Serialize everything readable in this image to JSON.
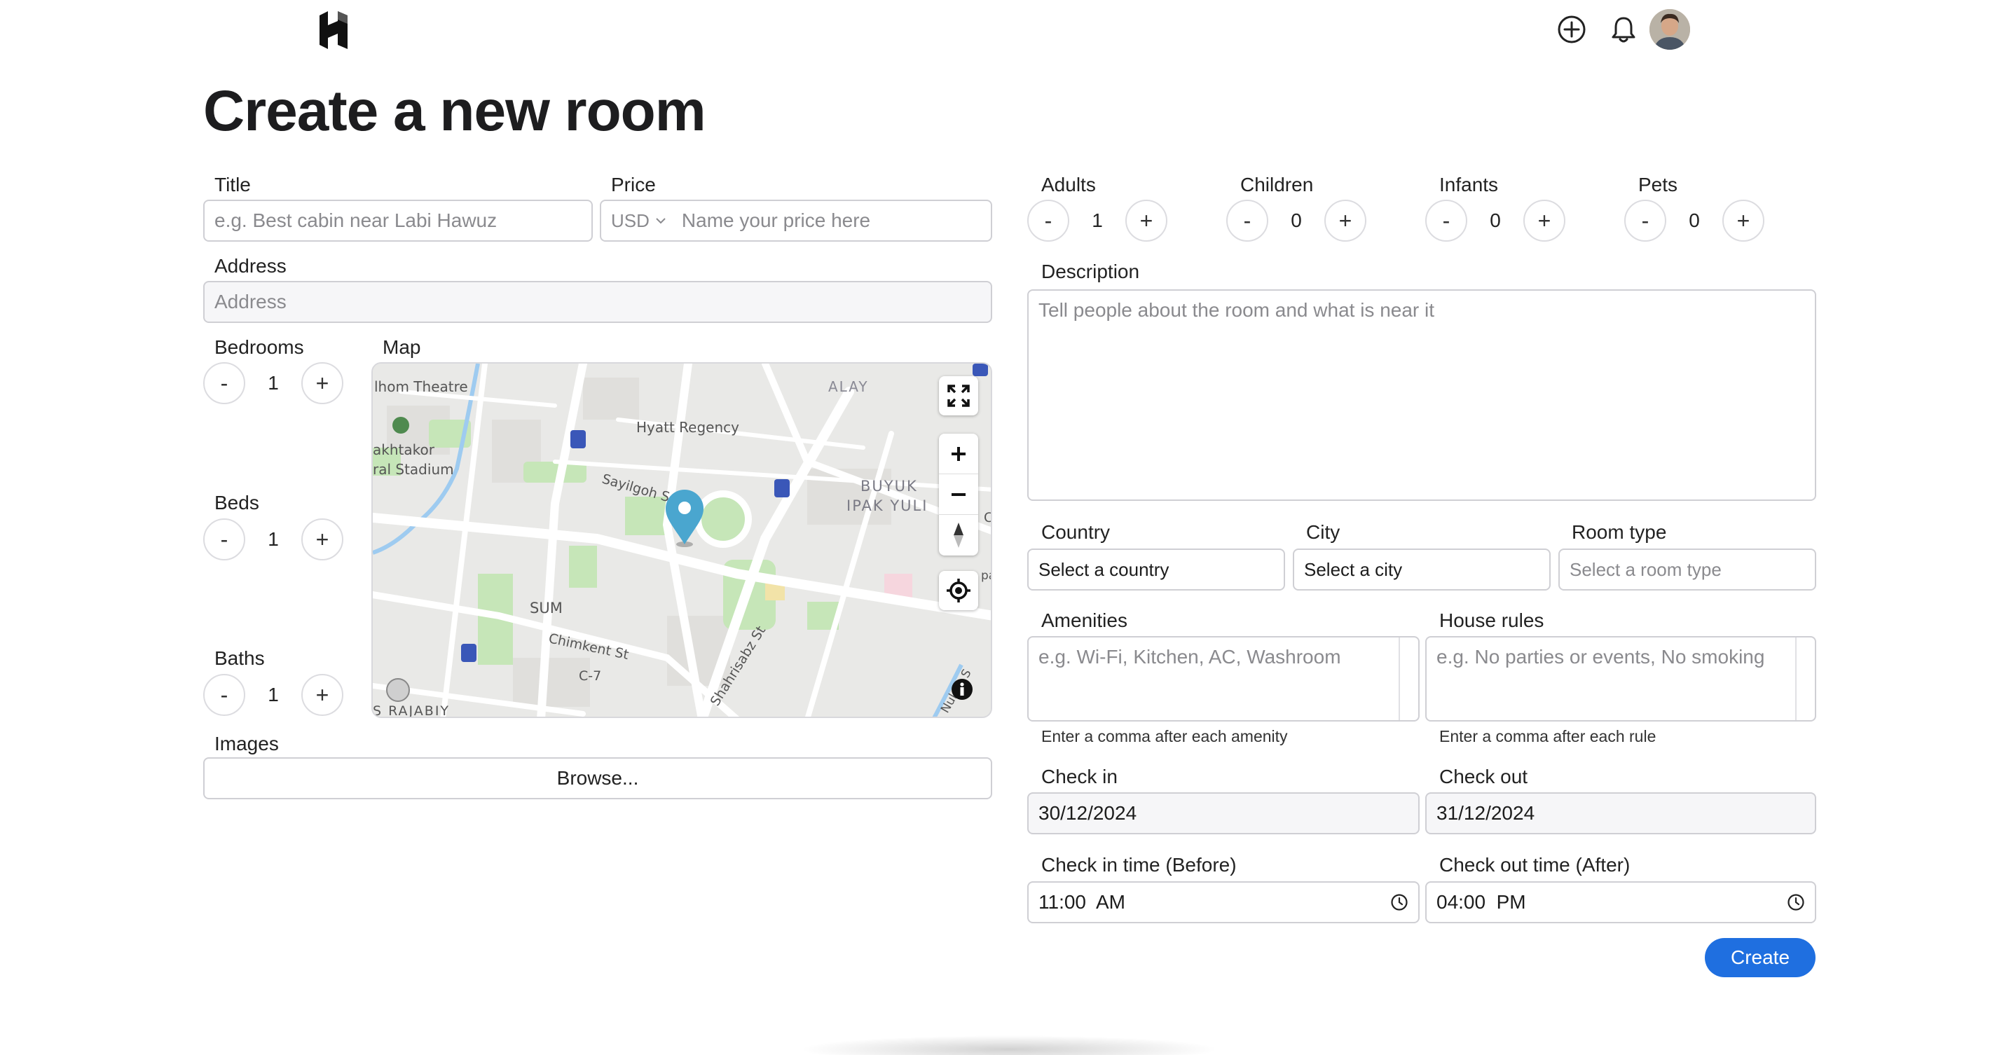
{
  "app": {
    "logo_letter": "H"
  },
  "header": {
    "add_icon": "plus-circle-icon",
    "bell_icon": "bell-icon",
    "avatar_icon": "user-avatar"
  },
  "page": {
    "title": "Create a new room"
  },
  "form": {
    "title": {
      "label": "Title",
      "placeholder": "e.g. Best cabin near Labi Hawuz"
    },
    "price": {
      "label": "Price",
      "currency": "USD",
      "placeholder": "Name your price here"
    },
    "address": {
      "label": "Address",
      "placeholder": "Address"
    },
    "bedrooms": {
      "label": "Bedrooms",
      "value": "1",
      "minus": "-",
      "plus": "+"
    },
    "beds": {
      "label": "Beds",
      "value": "1",
      "minus": "-",
      "plus": "+"
    },
    "baths": {
      "label": "Baths",
      "value": "1",
      "minus": "-",
      "plus": "+"
    },
    "map": {
      "label": "Map",
      "places": {
        "theatre": "lhom Theatre",
        "alay": "ALAY",
        "hyatt": "Hyatt Regency",
        "stadium1": "akhtakor",
        "stadium2": "ral Stadium",
        "sayilgoh": "Sayilgoh S",
        "buyuk1": "BUYUK",
        "buyuk2": "IPAK YULI",
        "sum": "SUM",
        "chimkent": "Chimkent St",
        "c7": "C-7",
        "shahrisabz": "Shahrisabz St",
        "rajabiy": "S RAJABIY",
        "nukus": "Nukus S",
        "pa": "pa",
        "c_edge": "C"
      }
    },
    "images": {
      "label": "Images",
      "browse": "Browse..."
    },
    "adults": {
      "label": "Adults",
      "value": "1",
      "minus": "-",
      "plus": "+"
    },
    "children": {
      "label": "Children",
      "value": "0",
      "minus": "-",
      "plus": "+"
    },
    "infants": {
      "label": "Infants",
      "value": "0",
      "minus": "-",
      "plus": "+"
    },
    "pets": {
      "label": "Pets",
      "value": "0",
      "minus": "-",
      "plus": "+"
    },
    "description": {
      "label": "Description",
      "placeholder": "Tell people about the room and what is near it"
    },
    "country": {
      "label": "Country",
      "value": "Select a country"
    },
    "city": {
      "label": "City",
      "value": "Select a city"
    },
    "room_type": {
      "label": "Room type",
      "value": "Select a room type"
    },
    "amenities": {
      "label": "Amenities",
      "placeholder": "e.g. Wi-Fi, Kitchen, AC, Washroom",
      "hint": "Enter a comma after each amenity"
    },
    "house_rules": {
      "label": "House rules",
      "placeholder": "e.g. No parties or events, No smoking",
      "hint": "Enter a comma after each rule"
    },
    "check_in": {
      "label": "Check in",
      "value": "30/12/2024"
    },
    "check_out": {
      "label": "Check out",
      "value": "31/12/2024"
    },
    "check_in_time": {
      "label": "Check in time (Before)",
      "value": "11:00  AM"
    },
    "check_out_time": {
      "label": "Check out time (After)",
      "value": "04:00  PM"
    },
    "create": "Create"
  }
}
